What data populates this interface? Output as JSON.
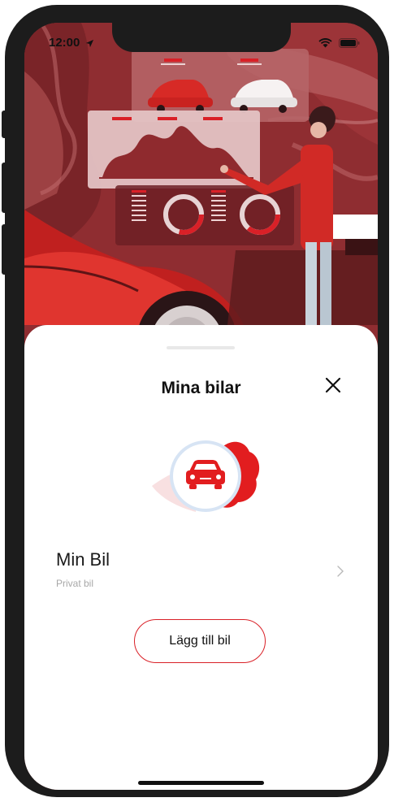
{
  "status_bar": {
    "time": "12:00"
  },
  "sheet": {
    "title": "Mina bilar",
    "car": {
      "name": "Min Bil",
      "type": "Privat bil"
    },
    "add_button_label": "Lägg till bil"
  },
  "icons": [
    "location-arrow-icon",
    "wifi-icon",
    "battery-icon",
    "close-icon",
    "car-icon",
    "chevron-right-icon"
  ],
  "colors": {
    "accent": "#d92027",
    "hero_bg": "#8e2c30",
    "text": "#111111",
    "subtext": "#a8a8a8"
  }
}
